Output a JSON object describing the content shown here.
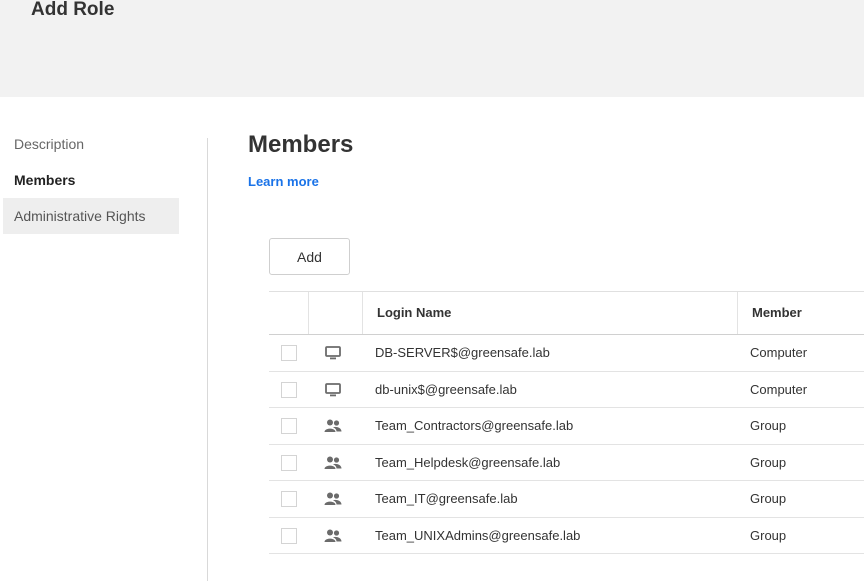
{
  "header": {
    "title": "Add Role"
  },
  "sidebar": {
    "items": [
      {
        "label": "Description"
      },
      {
        "label": "Members"
      },
      {
        "label": "Administrative Rights"
      }
    ]
  },
  "main": {
    "title": "Members",
    "learn_more": "Learn more",
    "add_button": "Add"
  },
  "table": {
    "columns": [
      "Login Name",
      "Member"
    ],
    "rows": [
      {
        "icon": "computer-icon",
        "login": "DB-SERVER$@greensafe.lab",
        "member": "Computer"
      },
      {
        "icon": "computer-icon",
        "login": "db-unix$@greensafe.lab",
        "member": "Computer"
      },
      {
        "icon": "group-icon",
        "login": "Team_Contractors@greensafe.lab",
        "member": "Group"
      },
      {
        "icon": "group-icon",
        "login": "Team_Helpdesk@greensafe.lab",
        "member": "Group"
      },
      {
        "icon": "group-icon",
        "login": "Team_IT@greensafe.lab",
        "member": "Group"
      },
      {
        "icon": "group-icon",
        "login": "Team_UNIXAdmins@greensafe.lab",
        "member": "Group"
      }
    ]
  },
  "colors": {
    "header_bg": "#f2f2f2",
    "link": "#1a73e8",
    "selected_bg": "#eeeeee",
    "icon": "#6b6b6b"
  }
}
